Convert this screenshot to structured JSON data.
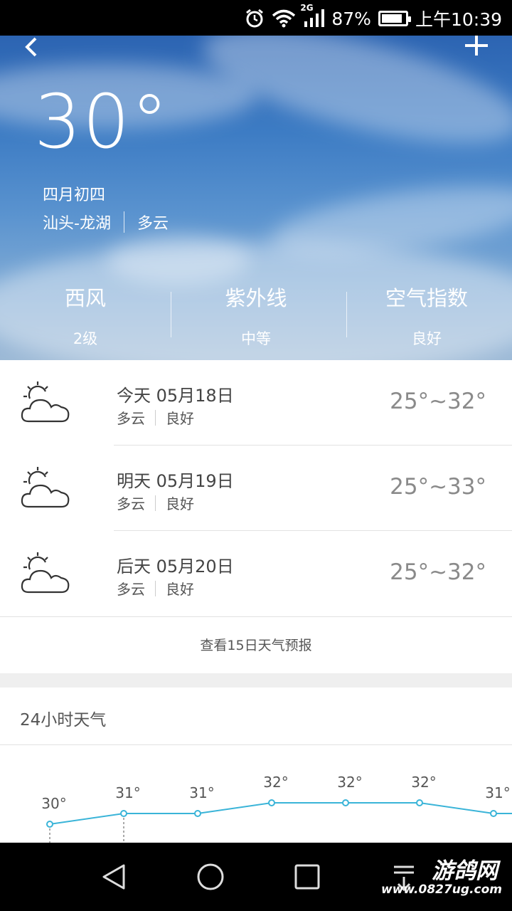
{
  "status_bar": {
    "network": "2G",
    "battery_percent": "87%",
    "battery_level": 0.87,
    "time": "上午10:39"
  },
  "hero": {
    "temperature": "30°",
    "lunar_date": "四月初四",
    "location": "汕头-龙湖",
    "condition": "多云",
    "metrics": [
      {
        "label": "西风",
        "value": "2级"
      },
      {
        "label": "紫外线",
        "value": "中等"
      },
      {
        "label": "空气指数",
        "value": "良好"
      }
    ]
  },
  "forecast": {
    "days": [
      {
        "title": "今天 05月18日",
        "condition": "多云",
        "air": "良好",
        "temp_range": "25°~32°",
        "icon": "partly-cloudy-icon"
      },
      {
        "title": "明天 05月19日",
        "condition": "多云",
        "air": "良好",
        "temp_range": "25°~33°",
        "icon": "partly-cloudy-icon"
      },
      {
        "title": "后天 05月20日",
        "condition": "多云",
        "air": "良好",
        "temp_range": "25°~32°",
        "icon": "partly-cloudy-icon"
      }
    ],
    "more_link": "查看15日天气预报"
  },
  "hourly": {
    "title": "24小时天气",
    "temps": [
      30,
      31,
      31,
      32,
      32,
      32,
      31
    ],
    "labels": [
      "30°",
      "31°",
      "31°",
      "32°",
      "32°",
      "32°",
      "31°"
    ]
  },
  "colors": {
    "line": "#3ab4d8",
    "sky_top": "#2c64b2"
  },
  "watermark": {
    "title": "游鸽网",
    "url": "www.0827ug.com"
  }
}
